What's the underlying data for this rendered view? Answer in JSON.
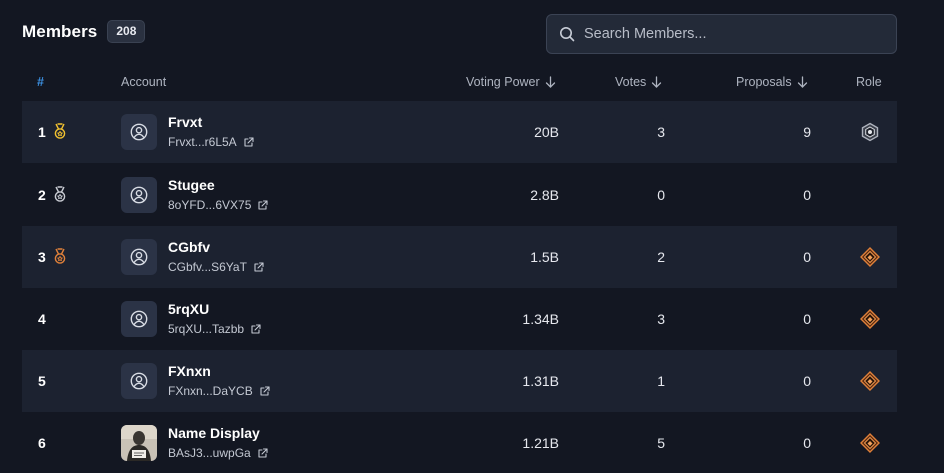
{
  "header": {
    "title": "Members",
    "count": "208"
  },
  "search": {
    "placeholder": "Search Members..."
  },
  "columns": {
    "rank": "#",
    "account": "Account",
    "voting_power": "Voting Power",
    "votes": "Votes",
    "proposals": "Proposals",
    "role": "Role"
  },
  "colors": {
    "background": "#131722",
    "row_alt": "#1c2230",
    "accent_blue": "#3b8fe0",
    "gold": "#f2c230",
    "silver": "#c9ccd3",
    "bronze": "#e0813a"
  },
  "members": [
    {
      "rank": "1",
      "medal": "gold-medal-icon",
      "name": "Frvxt",
      "address": "Frvxt...r6L5A",
      "voting_power": "20B",
      "votes": "3",
      "proposals": "9",
      "role": "admin-badge-icon"
    },
    {
      "rank": "2",
      "medal": "silver-medal-icon",
      "name": "Stugee",
      "address": "8oYFD...6VX75",
      "voting_power": "2.8B",
      "votes": "0",
      "proposals": "0",
      "role": ""
    },
    {
      "rank": "3",
      "medal": "bronze-medal-icon",
      "name": "CGbfv",
      "address": "CGbfv...S6YaT",
      "voting_power": "1.5B",
      "votes": "2",
      "proposals": "0",
      "role": "member-badge-icon"
    },
    {
      "rank": "4",
      "medal": "",
      "name": "5rqXU",
      "address": "5rqXU...Tazbb",
      "voting_power": "1.34B",
      "votes": "3",
      "proposals": "0",
      "role": "member-badge-icon"
    },
    {
      "rank": "5",
      "medal": "",
      "name": "FXnxn",
      "address": "FXnxn...DaYCB",
      "voting_power": "1.31B",
      "votes": "1",
      "proposals": "0",
      "role": "member-badge-icon"
    },
    {
      "rank": "6",
      "medal": "",
      "name": "Name Display",
      "address": "BAsJ3...uwpGa",
      "voting_power": "1.21B",
      "votes": "5",
      "proposals": "0",
      "role": "member-badge-icon"
    }
  ]
}
